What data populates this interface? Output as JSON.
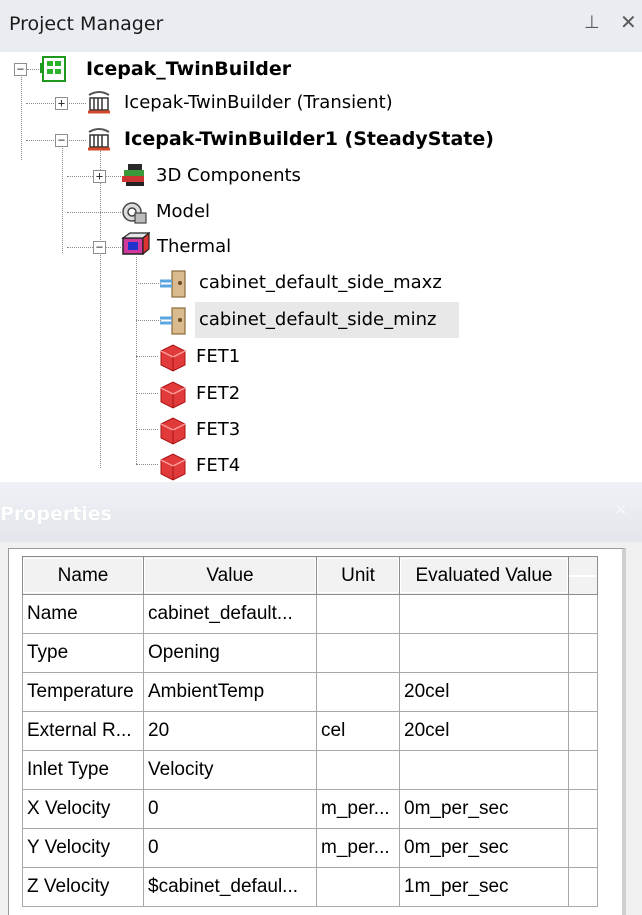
{
  "project_manager": {
    "title": "Project Manager",
    "pin_icon": "pin-icon",
    "close_icon": "close-icon",
    "tree": {
      "root": "Icepak_TwinBuilder",
      "design_transient": "Icepak-TwinBuilder (Transient)",
      "design_steady": "Icepak-TwinBuilder1 (SteadyState)",
      "components": "3D Components",
      "model": "Model",
      "thermal": "Thermal",
      "thermal_children": [
        "cabinet_default_side_maxz",
        "cabinet_default_side_minz",
        "FET1",
        "FET2",
        "FET3",
        "FET4"
      ],
      "selected": "cabinet_default_side_minz"
    }
  },
  "properties": {
    "title": "Properties",
    "columns": [
      "Name",
      "Value",
      "Unit",
      "Evaluated Value",
      ""
    ],
    "rows": [
      [
        "Name",
        "cabinet_default...",
        "",
        ""
      ],
      [
        "Type",
        "Opening",
        "",
        ""
      ],
      [
        "Temperature",
        "AmbientTemp",
        "",
        "20cel"
      ],
      [
        "External R...",
        "20",
        "cel",
        "20cel"
      ],
      [
        "Inlet Type",
        "Velocity",
        "",
        ""
      ],
      [
        "X Velocity",
        "0",
        "m_per...",
        "0m_per_sec"
      ],
      [
        "Y Velocity",
        "0",
        "m_per...",
        "0m_per_sec"
      ],
      [
        "Z Velocity",
        "$cabinet_defaul...",
        "",
        "1m_per_sec"
      ]
    ]
  }
}
